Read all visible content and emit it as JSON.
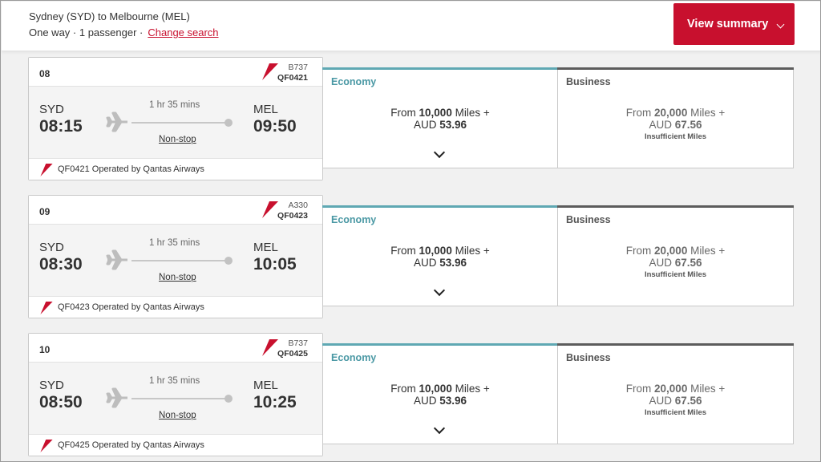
{
  "header": {
    "route": "Sydney (SYD) to Melbourne (MEL)",
    "trip_info": "One way · 1 passenger ·",
    "change_search": "Change search",
    "summary_button": "View summary"
  },
  "colors": {
    "brand_red": "#c8102e",
    "economy_teal": "#5fa8b3",
    "business_gray": "#5c5c5c"
  },
  "flights": [
    {
      "number": "08",
      "aircraft": "B737",
      "code": "QF0421",
      "from": "SYD",
      "dep_time": "08:15",
      "to": "MEL",
      "arr_time": "09:50",
      "duration": "1 hr 35 mins",
      "stops": "Non-stop",
      "operated": "QF0421 Operated by Qantas Airways",
      "economy": {
        "label": "Economy",
        "prefix": "From",
        "miles": "10,000",
        "miles_unit": "Miles +",
        "currency": "AUD",
        "amount": "53.96"
      },
      "business": {
        "label": "Business",
        "prefix": "From",
        "miles": "20,000",
        "miles_unit": "Miles +",
        "currency": "AUD",
        "amount": "67.56",
        "note": "Insufficient Miles"
      }
    },
    {
      "number": "09",
      "aircraft": "A330",
      "code": "QF0423",
      "from": "SYD",
      "dep_time": "08:30",
      "to": "MEL",
      "arr_time": "10:05",
      "duration": "1 hr 35 mins",
      "stops": "Non-stop",
      "operated": "QF0423 Operated by Qantas Airways",
      "economy": {
        "label": "Economy",
        "prefix": "From",
        "miles": "10,000",
        "miles_unit": "Miles +",
        "currency": "AUD",
        "amount": "53.96"
      },
      "business": {
        "label": "Business",
        "prefix": "From",
        "miles": "20,000",
        "miles_unit": "Miles +",
        "currency": "AUD",
        "amount": "67.56",
        "note": "Insufficient Miles"
      }
    },
    {
      "number": "10",
      "aircraft": "B737",
      "code": "QF0425",
      "from": "SYD",
      "dep_time": "08:50",
      "to": "MEL",
      "arr_time": "10:25",
      "duration": "1 hr 35 mins",
      "stops": "Non-stop",
      "operated": "QF0425 Operated by Qantas Airways",
      "economy": {
        "label": "Economy",
        "prefix": "From",
        "miles": "10,000",
        "miles_unit": "Miles +",
        "currency": "AUD",
        "amount": "53.96"
      },
      "business": {
        "label": "Business",
        "prefix": "From",
        "miles": "20,000",
        "miles_unit": "Miles +",
        "currency": "AUD",
        "amount": "67.56",
        "note": "Insufficient Miles"
      }
    }
  ]
}
